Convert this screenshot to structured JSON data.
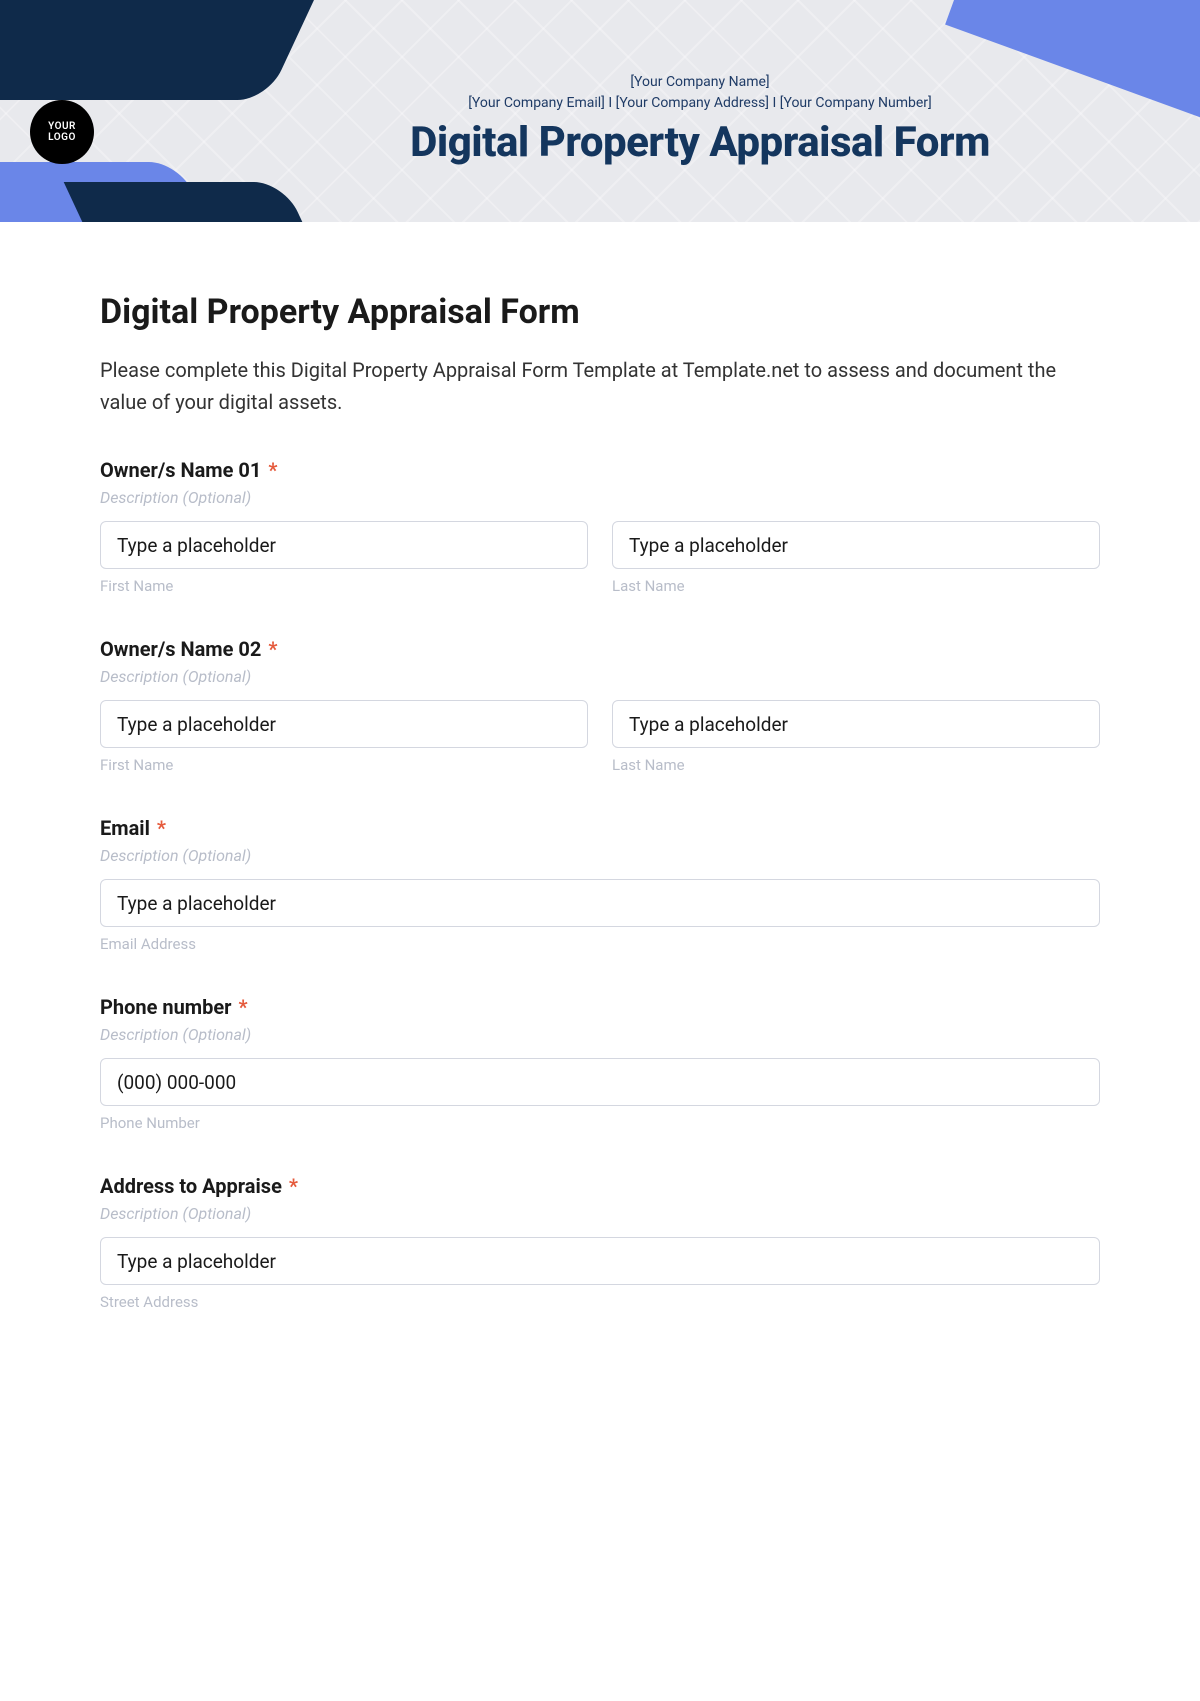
{
  "banner": {
    "logo_line1": "YOUR",
    "logo_line2": "LOGO",
    "meta_line1": "[Your Company Name]",
    "meta_line2": "[Your Company Email] I [Your Company Address] I [Your Company Number]",
    "title": "Digital Property Appraisal Form"
  },
  "form": {
    "title": "Digital Property Appraisal Form",
    "intro": "Please complete this Digital Property Appraisal Form Template at Template.net to assess and document the value of your digital assets.",
    "required_mark": "*",
    "desc_placeholder": "Description (Optional)",
    "owner1": {
      "label": "Owner/s Name 01",
      "first_ph": "Type a placeholder",
      "first_sub": "First Name",
      "last_ph": "Type a placeholder",
      "last_sub": "Last Name"
    },
    "owner2": {
      "label": "Owner/s Name 02",
      "first_ph": "Type a placeholder",
      "first_sub": "First Name",
      "last_ph": "Type a placeholder",
      "last_sub": "Last Name"
    },
    "email": {
      "label": "Email",
      "ph": "Type a placeholder",
      "sub": "Email Address"
    },
    "phone": {
      "label": "Phone number",
      "ph": "(000) 000-000",
      "sub": "Phone Number"
    },
    "address": {
      "label": "Address to Appraise",
      "ph": "Type a placeholder",
      "sub": "Street Address"
    }
  }
}
